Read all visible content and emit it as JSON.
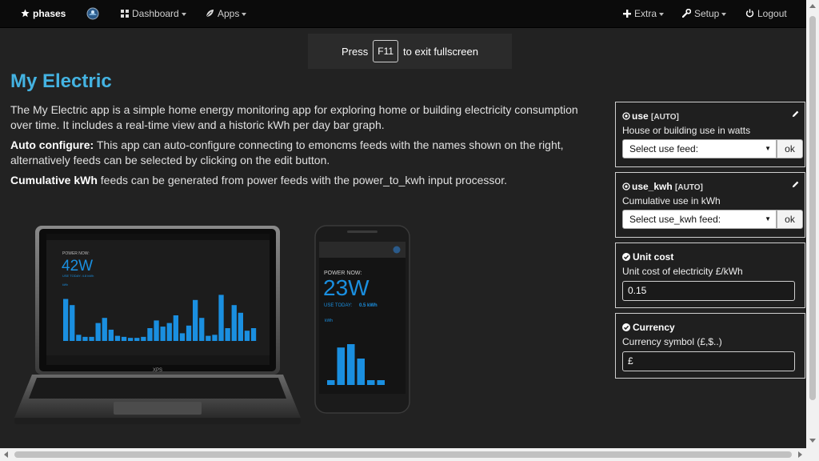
{
  "nav": {
    "brand": "phases",
    "dashboard": "Dashboard",
    "apps": "Apps",
    "extra": "Extra",
    "setup": "Setup",
    "logout": "Logout"
  },
  "fullscreen": {
    "press": "Press",
    "key": "F11",
    "rest": "to exit fullscreen"
  },
  "page": {
    "title": "My Electric",
    "intro": "The My Electric app is a simple home energy monitoring app for exploring home or building electricity consumption over time. It includes a real-time view and a historic kWh per day bar graph.",
    "auto_label": "Auto configure:",
    "auto_text": " This app can auto-configure connecting to emoncms feeds with the names shown on the right, alternatively feeds can be selected by clicking on the edit button.",
    "cum_label": "Cumulative kWh",
    "cum_text": " feeds can be generated from power feeds with the power_to_kwh input processor."
  },
  "config": {
    "use": {
      "name": "use",
      "tag": "[AUTO]",
      "desc": "House or building use in watts",
      "select": "Select use feed:",
      "ok": "ok"
    },
    "use_kwh": {
      "name": "use_kwh",
      "tag": "[AUTO]",
      "desc": "Cumulative use in kWh",
      "select": "Select use_kwh feed:",
      "ok": "ok"
    },
    "unitcost": {
      "name": "Unit cost",
      "desc": "Unit cost of electricity £/kWh",
      "value": "0.15"
    },
    "currency": {
      "name": "Currency",
      "desc": "Currency symbol (£,$..)",
      "value": "£"
    }
  },
  "devices": {
    "laptop": {
      "label": "POWER NOW:",
      "value": "42W",
      "today": "USE TODAY: 4.8 kWh",
      "unit": "kWh",
      "brand": "XPS"
    },
    "phone": {
      "label": "POWER NOW:",
      "value": "23W",
      "today_label": "USE TODAY:",
      "today_value": "0.5 kWh",
      "unit": "kWh"
    },
    "laptop_bars": [
      0.82,
      0.7,
      0.12,
      0.08,
      0.08,
      0.35,
      0.45,
      0.22,
      0.1,
      0.08,
      0.06,
      0.06,
      0.08,
      0.25,
      0.4,
      0.28,
      0.35,
      0.5,
      0.15,
      0.3,
      0.8,
      0.45,
      0.1,
      0.12,
      0.9,
      0.25,
      0.7,
      0.55,
      0.2,
      0.25
    ],
    "phone_bars": [
      0.1,
      0.78,
      0.85,
      0.55,
      0.1,
      0.1
    ]
  },
  "colors": {
    "accent": "#44b3e2",
    "bar": "#1a8fe0",
    "panel_border": "#cfcfcf"
  }
}
